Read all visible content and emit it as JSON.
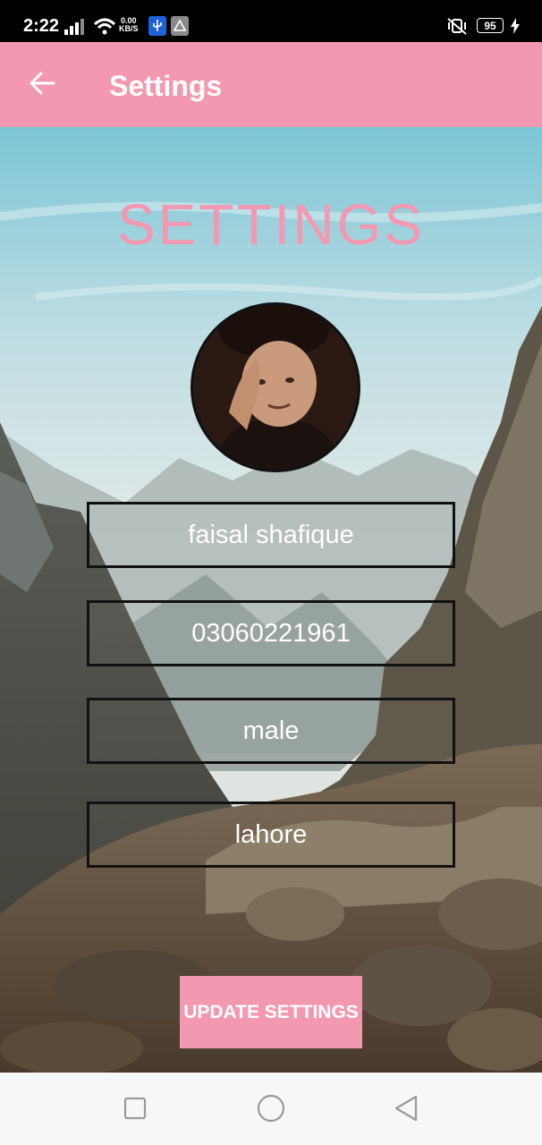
{
  "status_bar": {
    "time": "2:22",
    "net_speed_value": "0.00",
    "net_speed_unit": "KB/S",
    "battery": "95"
  },
  "app_bar": {
    "title": "Settings",
    "back_icon": "arrow-left-icon"
  },
  "main": {
    "heading": "SETTINGS",
    "fields": {
      "name": "faisal shafique",
      "phone": "03060221961",
      "gender": "male",
      "city": "lahore"
    },
    "update_button_label": "UPDATE SETTINGS"
  },
  "colors": {
    "accent_pink": "#f298b0",
    "field_border": "#111111",
    "nav_background": "#f7f7f7"
  },
  "nav_bar": {
    "icons": [
      "square-icon",
      "circle-icon",
      "triangle-back-icon"
    ]
  }
}
